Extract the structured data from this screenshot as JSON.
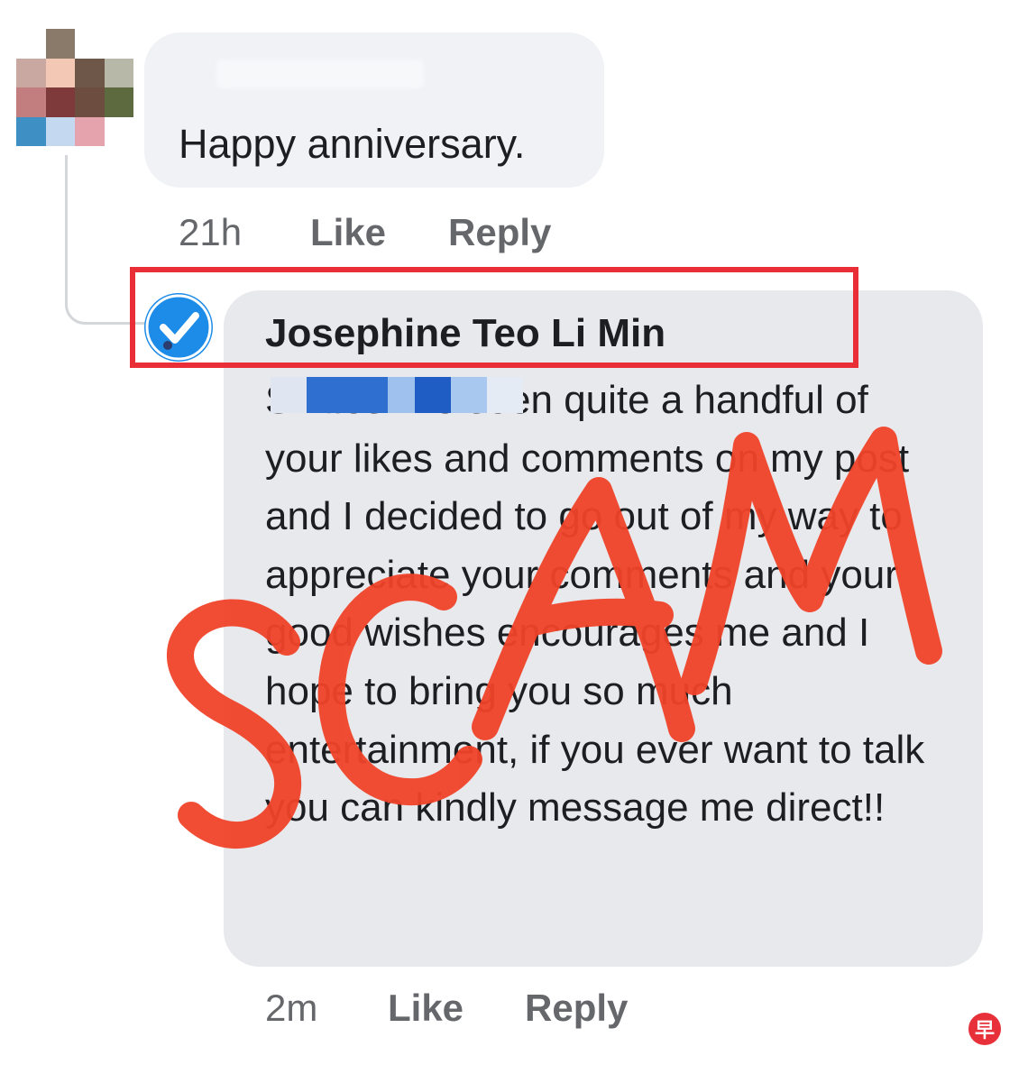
{
  "comment": {
    "text": "Happy anniversary.",
    "time": "21h",
    "like_label": "Like",
    "reply_label": "Reply"
  },
  "reply": {
    "author": "Josephine Teo Li Min",
    "text": "Smiles I've seen quite a handful of your likes and comments on my post and I decided to go out of my way to appreciate your comments and your good wishes encourages me and I hope to bring you so much entertainment, if you ever want to talk you can kindly message me direct!!",
    "time": "2m",
    "like_label": "Like",
    "reply_label": "Reply"
  },
  "overlay": {
    "stamp_text": "SCAM",
    "stamp_color": "#f0432a",
    "highlight_color": "#ea2e37"
  },
  "watermark": {
    "text": "早"
  },
  "icons": {
    "verified": "verified-check-icon"
  }
}
